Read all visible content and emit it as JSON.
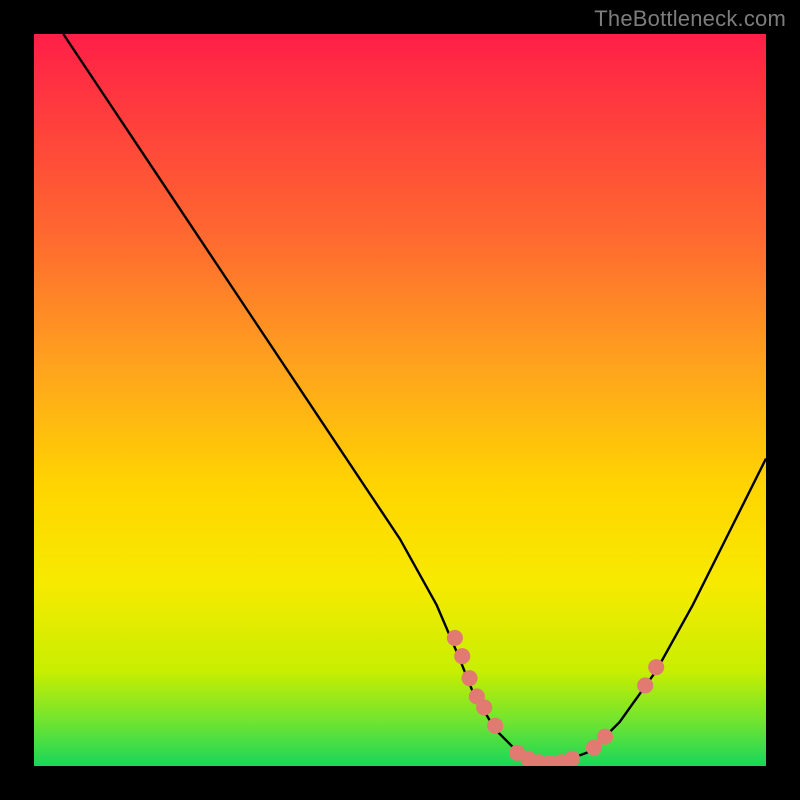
{
  "attribution": "TheBottleneck.com",
  "chart_data": {
    "type": "line",
    "title": "",
    "xlabel": "",
    "ylabel": "",
    "xlim": [
      0,
      100
    ],
    "ylim": [
      0,
      100
    ],
    "series": [
      {
        "name": "curve",
        "x": [
          4,
          10,
          20,
          30,
          40,
          50,
          55,
          58,
          60,
          63,
          66,
          69,
          72,
          76,
          80,
          85,
          90,
          95,
          100
        ],
        "y": [
          100,
          91,
          76,
          61,
          46,
          31,
          22,
          15,
          10,
          5,
          2,
          0.5,
          0.5,
          2,
          6,
          13,
          22,
          32,
          42
        ]
      }
    ],
    "markers": [
      {
        "x": 57.5,
        "y": 17.5,
        "r": 1.1
      },
      {
        "x": 58.5,
        "y": 15.0,
        "r": 1.1
      },
      {
        "x": 59.5,
        "y": 12.0,
        "r": 1.1
      },
      {
        "x": 60.5,
        "y": 9.5,
        "r": 1.1
      },
      {
        "x": 61.5,
        "y": 8.0,
        "r": 1.1
      },
      {
        "x": 63.0,
        "y": 5.5,
        "r": 1.1
      },
      {
        "x": 66.0,
        "y": 1.8,
        "r": 1.1
      },
      {
        "x": 67.5,
        "y": 1.0,
        "r": 1.1
      },
      {
        "x": 69.0,
        "y": 0.5,
        "r": 1.1
      },
      {
        "x": 70.5,
        "y": 0.4,
        "r": 1.1
      },
      {
        "x": 72.0,
        "y": 0.5,
        "r": 1.1
      },
      {
        "x": 73.5,
        "y": 1.0,
        "r": 1.1
      },
      {
        "x": 76.5,
        "y": 2.5,
        "r": 1.1
      },
      {
        "x": 78.0,
        "y": 4.0,
        "r": 1.1
      },
      {
        "x": 83.5,
        "y": 11.0,
        "r": 1.1
      },
      {
        "x": 85.0,
        "y": 13.5,
        "r": 1.1
      }
    ],
    "colors": {
      "curve_stroke": "#000000",
      "marker_fill": "#e17b72"
    }
  }
}
